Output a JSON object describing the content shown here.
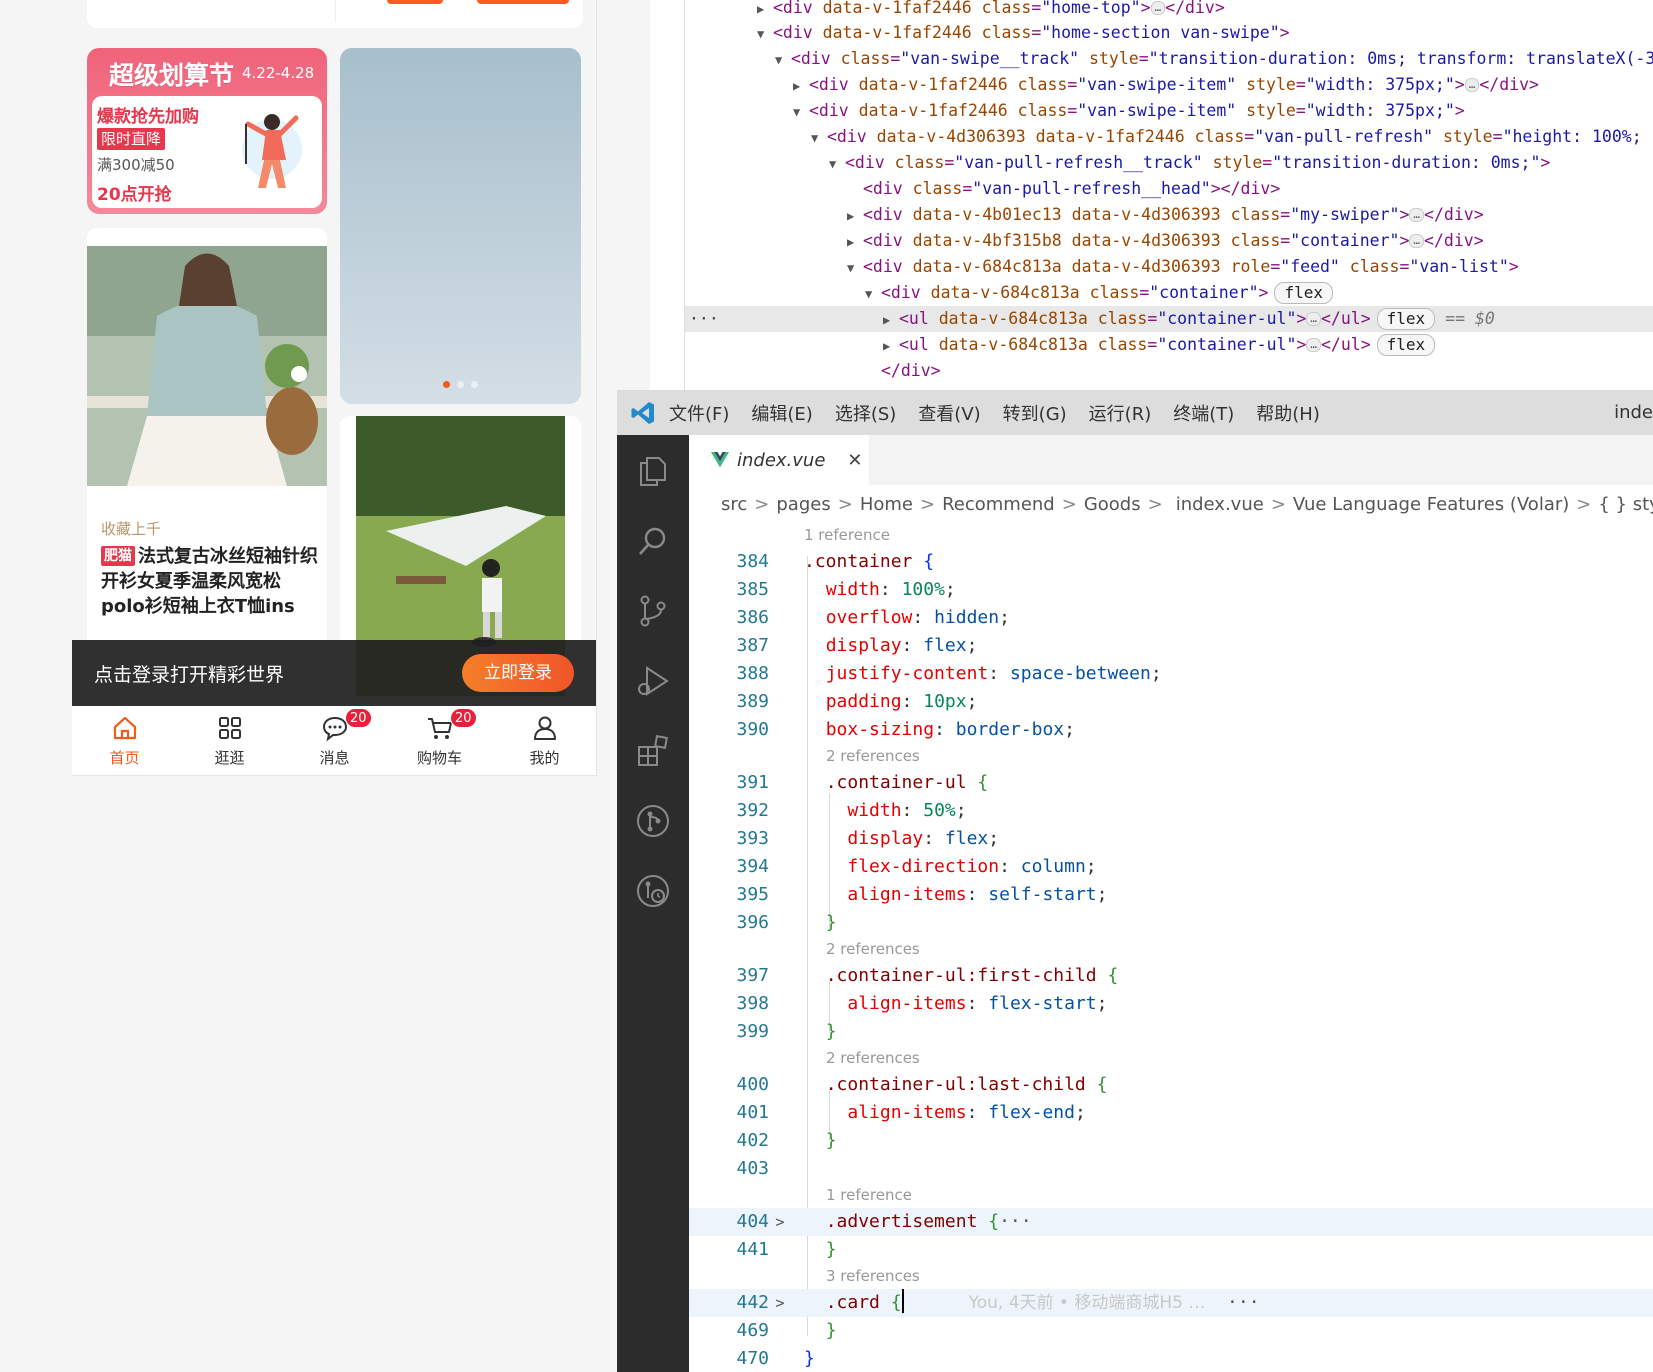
{
  "mobile": {
    "promo": {
      "heading": "超级划算节",
      "date": "4.22-4.28",
      "line1": "爆款抢先加购",
      "line2": "限时直降",
      "line3": "满300减50",
      "line4": "20点开抢"
    },
    "swiper": {
      "dot_count": 3,
      "active_dot": 0,
      "active_color": "#f25a1f"
    },
    "goods_a": {
      "tag": "收藏上千",
      "shop_badge": "肥猫",
      "title": "法式复古冰丝短袖针织开衫女夏季温柔风宽松polo衫短袖上衣T恤ins"
    },
    "login_bar": {
      "text": "点击登录打开精彩世界",
      "button": "立即登录"
    },
    "tabbar": [
      {
        "label": "首页",
        "icon": "home-icon",
        "active": true
      },
      {
        "label": "逛逛",
        "icon": "grid-icon",
        "active": false
      },
      {
        "label": "消息",
        "icon": "chat-icon",
        "badge": "20",
        "active": false
      },
      {
        "label": "购物车",
        "icon": "cart-icon",
        "badge": "20",
        "active": false
      },
      {
        "label": "我的",
        "icon": "user-icon",
        "active": false
      }
    ],
    "accent_color": "#f25a1f"
  },
  "devtools": {
    "selected_marker": "== $0",
    "dots": "···",
    "lines": [
      {
        "tri": "▶",
        "open": "<div data-v-1faf2446 class=\"home-top\">",
        "ellipsis": true,
        "close": "</div>"
      },
      {
        "tri": "▼",
        "open": "<div data-v-1faf2446 class=\"home-section van-swipe\">"
      },
      {
        "tri": "▼",
        "open": "<div class=\"van-swipe__track\" style=\"transition-duration: 0ms; transform: translateX(-3"
      },
      {
        "tri": "▶",
        "open": "<div data-v-1faf2446 class=\"van-swipe-item\" style=\"width: 375px;\">",
        "ellipsis": true,
        "close": "</div>"
      },
      {
        "tri": "▼",
        "open": "<div data-v-1faf2446 class=\"van-swipe-item\" style=\"width: 375px;\">"
      },
      {
        "tri": "▼",
        "open": "<div data-v-4d306393 data-v-1faf2446 class=\"van-pull-refresh\" style=\"height: 100%;"
      },
      {
        "tri": "▼",
        "open": "<div class=\"van-pull-refresh__track\" style=\"transition-duration: 0ms;\">"
      },
      {
        "tri": "",
        "open": "<div class=\"van-pull-refresh__head\"></div>"
      },
      {
        "tri": "▶",
        "open": "<div data-v-4b01ec13 data-v-4d306393 class=\"my-swiper\">",
        "ellipsis": true,
        "close": "</div>"
      },
      {
        "tri": "▶",
        "open": "<div data-v-4bf315b8 data-v-4d306393 class=\"container\">",
        "ellipsis": true,
        "close": "</div>"
      },
      {
        "tri": "▼",
        "open": "<div data-v-684c813a data-v-4d306393 role=\"feed\" class=\"van-list\">"
      },
      {
        "tri": "▼",
        "open": "<div data-v-684c813a class=\"container\">",
        "badge": "flex"
      },
      {
        "tri": "▶",
        "open": "<ul data-v-684c813a class=\"container-ul\">",
        "ellipsis": true,
        "close": "</ul>",
        "badge": "flex",
        "selected": true
      },
      {
        "tri": "▶",
        "open": "<ul data-v-684c813a class=\"container-ul\">",
        "ellipsis": true,
        "close": "</ul>",
        "badge": "flex"
      },
      {
        "tri": "",
        "open": "</div>"
      }
    ]
  },
  "vscode": {
    "menu": [
      "文件(F)",
      "编辑(E)",
      "选择(S)",
      "查看(V)",
      "转到(G)",
      "运行(R)",
      "终端(T)",
      "帮助(H)"
    ],
    "title_right": "inde",
    "tab": {
      "name": "index.vue",
      "close": "✕"
    },
    "breadcrumb": [
      "src",
      "pages",
      "Home",
      "Recommend",
      "Goods",
      "index.vue",
      "Vue Language Features (Volar)",
      "{ } style scop"
    ],
    "activity_icons": [
      "explorer-icon",
      "search-icon",
      "source-control-icon",
      "run-debug-icon",
      "extensions-icon",
      "git-graph-icon",
      "git-history-icon"
    ],
    "lenses": {
      "l384": "1 reference",
      "l391": "2 references",
      "l397": "2 references",
      "l400": "2 references",
      "l404": "1 reference",
      "l442": "3 references"
    },
    "blame": "You, 4天前 • 移动端商城H5 …",
    "more": "···",
    "line_numbers": [
      "384",
      "385",
      "386",
      "387",
      "388",
      "389",
      "390",
      "391",
      "392",
      "393",
      "394",
      "395",
      "396",
      "397",
      "398",
      "399",
      "400",
      "401",
      "402",
      "403",
      "404",
      "441",
      "442",
      "469",
      "470"
    ],
    "code": {
      "l384": ".container",
      "l385_p": "width",
      "l385_v": "100%",
      "l386_p": "overflow",
      "l386_v": "hidden",
      "l387_p": "display",
      "l387_v": "flex",
      "l388_p": "justify-content",
      "l388_v": "space-between",
      "l389_p": "padding",
      "l389_v": "10px",
      "l390_p": "box-sizing",
      "l390_v": "border-box",
      "l391": ".container-ul",
      "l392_p": "width",
      "l392_v": "50%",
      "l393_p": "display",
      "l393_v": "flex",
      "l394_p": "flex-direction",
      "l394_v": "column",
      "l395_p": "align-items",
      "l395_v": "self-start",
      "l397": ".container-ul:first-child",
      "l398_p": "align-items",
      "l398_v": "flex-start",
      "l400": ".container-ul:last-child",
      "l401_p": "align-items",
      "l401_v": "flex-end",
      "l404": ".advertisement",
      "l442": ".card"
    }
  }
}
